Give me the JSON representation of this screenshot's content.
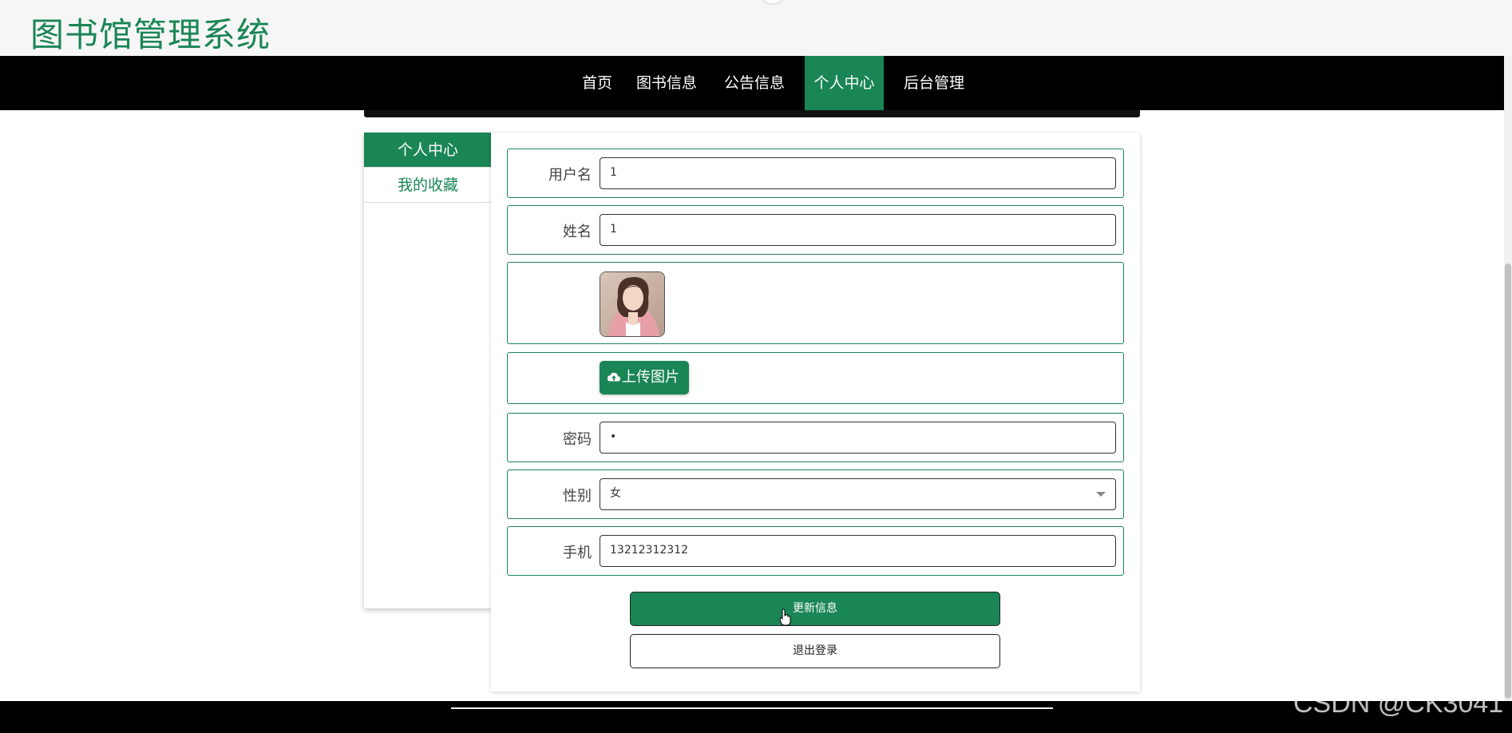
{
  "site": {
    "title": "图书馆管理系统"
  },
  "nav": {
    "items": [
      {
        "label": "首页"
      },
      {
        "label": "图书信息"
      },
      {
        "label": "公告信息"
      },
      {
        "label": "个人中心"
      },
      {
        "label": "后台管理"
      }
    ]
  },
  "sidebar": {
    "items": [
      {
        "label": "个人中心"
      },
      {
        "label": "我的收藏"
      }
    ]
  },
  "form": {
    "username": {
      "label": "用户名",
      "value": "1"
    },
    "name": {
      "label": "姓名",
      "value": "1"
    },
    "upload": {
      "label": "上传图片"
    },
    "password": {
      "label": "密码",
      "value": "•"
    },
    "gender": {
      "label": "性别",
      "value": "女"
    },
    "phone": {
      "label": "手机",
      "value": "13212312312"
    }
  },
  "buttons": {
    "update": "更新信息",
    "logout": "退出登录"
  },
  "watermark": "CSDN @CK3041",
  "colors": {
    "accent": "#1a8555",
    "nav_bg": "#000000"
  }
}
